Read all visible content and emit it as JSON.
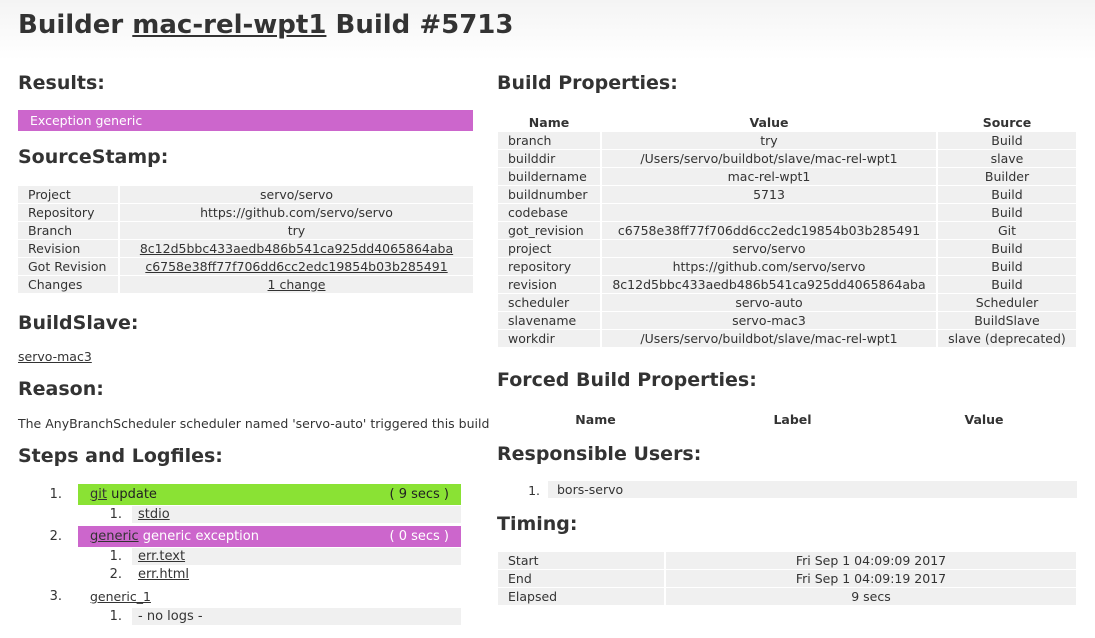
{
  "header": {
    "prefix": "Builder",
    "builder_name": "mac-rel-wpt1",
    "build_label": "Build #5713"
  },
  "results": {
    "heading": "Results:",
    "status": "Exception generic",
    "status_color": "#cc66cc"
  },
  "sourcestamp": {
    "heading": "SourceStamp:",
    "rows": [
      {
        "label": "Project",
        "value": "servo/servo",
        "link": false
      },
      {
        "label": "Repository",
        "value": "https://github.com/servo/servo",
        "link": false
      },
      {
        "label": "Branch",
        "value": "try",
        "link": false
      },
      {
        "label": "Revision",
        "value": "8c12d5bbc433aedb486b541ca925dd4065864aba",
        "link": true
      },
      {
        "label": "Got Revision",
        "value": "c6758e38ff77f706dd6cc2edc19854b03b285491",
        "link": true
      },
      {
        "label": "Changes",
        "value": "1 change",
        "link": true
      }
    ]
  },
  "buildslave": {
    "heading": "BuildSlave:",
    "name": "servo-mac3"
  },
  "reason": {
    "heading": "Reason:",
    "text": "The AnyBranchScheduler scheduler named 'servo-auto' triggered this build"
  },
  "steps": {
    "heading": "Steps and Logfiles:",
    "items": [
      {
        "num": "1.",
        "link": "git",
        "text": "update",
        "time": "( 9 secs )",
        "color": "#8ae234",
        "logs": [
          {
            "num": "1.",
            "name": "stdio",
            "link": true
          }
        ]
      },
      {
        "num": "2.",
        "link": "generic",
        "text": "generic exception",
        "time": "( 0 secs )",
        "color": "#cc66cc",
        "logs": [
          {
            "num": "1.",
            "name": "err.text",
            "link": true
          },
          {
            "num": "2.",
            "name": "err.html",
            "link": true
          }
        ]
      },
      {
        "num": "3.",
        "link": "generic_1",
        "text": "",
        "time": "",
        "color": "",
        "logs": [
          {
            "num": "1.",
            "name": "- no logs -",
            "link": false
          }
        ]
      }
    ]
  },
  "build_properties": {
    "heading": "Build Properties:",
    "columns": [
      "Name",
      "Value",
      "Source"
    ],
    "rows": [
      [
        "branch",
        "try",
        "Build"
      ],
      [
        "builddir",
        "/Users/servo/buildbot/slave/mac-rel-wpt1",
        "slave"
      ],
      [
        "buildername",
        "mac-rel-wpt1",
        "Builder"
      ],
      [
        "buildnumber",
        "5713",
        "Build"
      ],
      [
        "codebase",
        "",
        "Build"
      ],
      [
        "got_revision",
        "c6758e38ff77f706dd6cc2edc19854b03b285491",
        "Git"
      ],
      [
        "project",
        "servo/servo",
        "Build"
      ],
      [
        "repository",
        "https://github.com/servo/servo",
        "Build"
      ],
      [
        "revision",
        "8c12d5bbc433aedb486b541ca925dd4065864aba",
        "Build"
      ],
      [
        "scheduler",
        "servo-auto",
        "Scheduler"
      ],
      [
        "slavename",
        "servo-mac3",
        "BuildSlave"
      ],
      [
        "workdir",
        "/Users/servo/buildbot/slave/mac-rel-wpt1",
        "slave (deprecated)"
      ]
    ]
  },
  "forced_properties": {
    "heading": "Forced Build Properties:",
    "columns": [
      "Name",
      "Label",
      "Value"
    ]
  },
  "responsible_users": {
    "heading": "Responsible Users:",
    "users": [
      {
        "num": "1.",
        "name": "bors-servo"
      }
    ]
  },
  "timing": {
    "heading": "Timing:",
    "rows": [
      [
        "Start",
        "Fri Sep 1 04:09:09 2017"
      ],
      [
        "End",
        "Fri Sep 1 04:09:19 2017"
      ],
      [
        "Elapsed",
        "9 secs"
      ]
    ]
  }
}
